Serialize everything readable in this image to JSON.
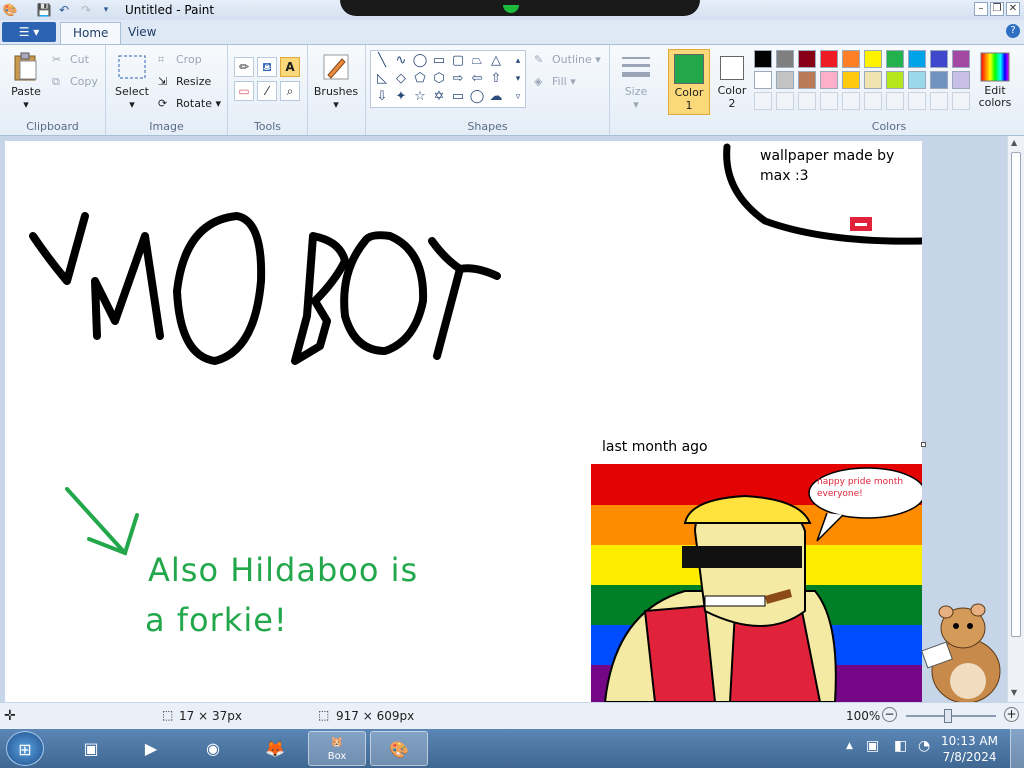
{
  "window": {
    "title": "Untitled - Paint"
  },
  "menu": {
    "tabs": [
      "Home",
      "View"
    ]
  },
  "clipboard": {
    "paste": "Paste",
    "cut": "Cut",
    "copy": "Copy",
    "label": "Clipboard"
  },
  "image": {
    "select": "Select",
    "crop": "Crop",
    "resize": "Resize",
    "rotate": "Rotate",
    "label": "Image"
  },
  "tools": {
    "label": "Tools"
  },
  "brushes": {
    "label": "Brushes"
  },
  "shapes": {
    "outline": "Outline",
    "fill": "Fill",
    "label": "Shapes"
  },
  "size": {
    "label": "Size"
  },
  "color1": {
    "label": "Color",
    "num": "1",
    "value": "#22a84b"
  },
  "color2": {
    "label": "Color",
    "num": "2",
    "value": "#ffffff"
  },
  "colors": {
    "label": "Colors",
    "edit": "Edit colors",
    "row1": [
      "#000000",
      "#7f7f7f",
      "#880015",
      "#ed1c24",
      "#ff7f27",
      "#fff200",
      "#22b14c",
      "#00a2e8",
      "#3f48cc",
      "#a349a4"
    ],
    "row2": [
      "#ffffff",
      "#c3c3c3",
      "#b97a57",
      "#ffaec9",
      "#ffc90e",
      "#efe4b0",
      "#b5e61d",
      "#99d9ea",
      "#7092be",
      "#c8bfe7"
    ],
    "row3": [
      "#f0f4f8",
      "#f0f4f8",
      "#f0f4f8",
      "#f0f4f8",
      "#f0f4f8",
      "#f0f4f8",
      "#f0f4f8",
      "#f0f4f8",
      "#f0f4f8",
      "#f0f4f8"
    ]
  },
  "canvas": {
    "wallpaper_text": "wallpaper made by max :3",
    "last_month": "last month ago",
    "green_text_1": "Also Hildaboo is",
    "green_text_2": "a forkie!",
    "bubble_text": "happy pride month everyone!"
  },
  "status": {
    "selection": "17 × 37px",
    "image_size": "917 × 609px",
    "zoom": "100%"
  },
  "taskbar": {
    "time": "10:13 AM",
    "date": "7/8/2024",
    "box_label": "Box"
  }
}
